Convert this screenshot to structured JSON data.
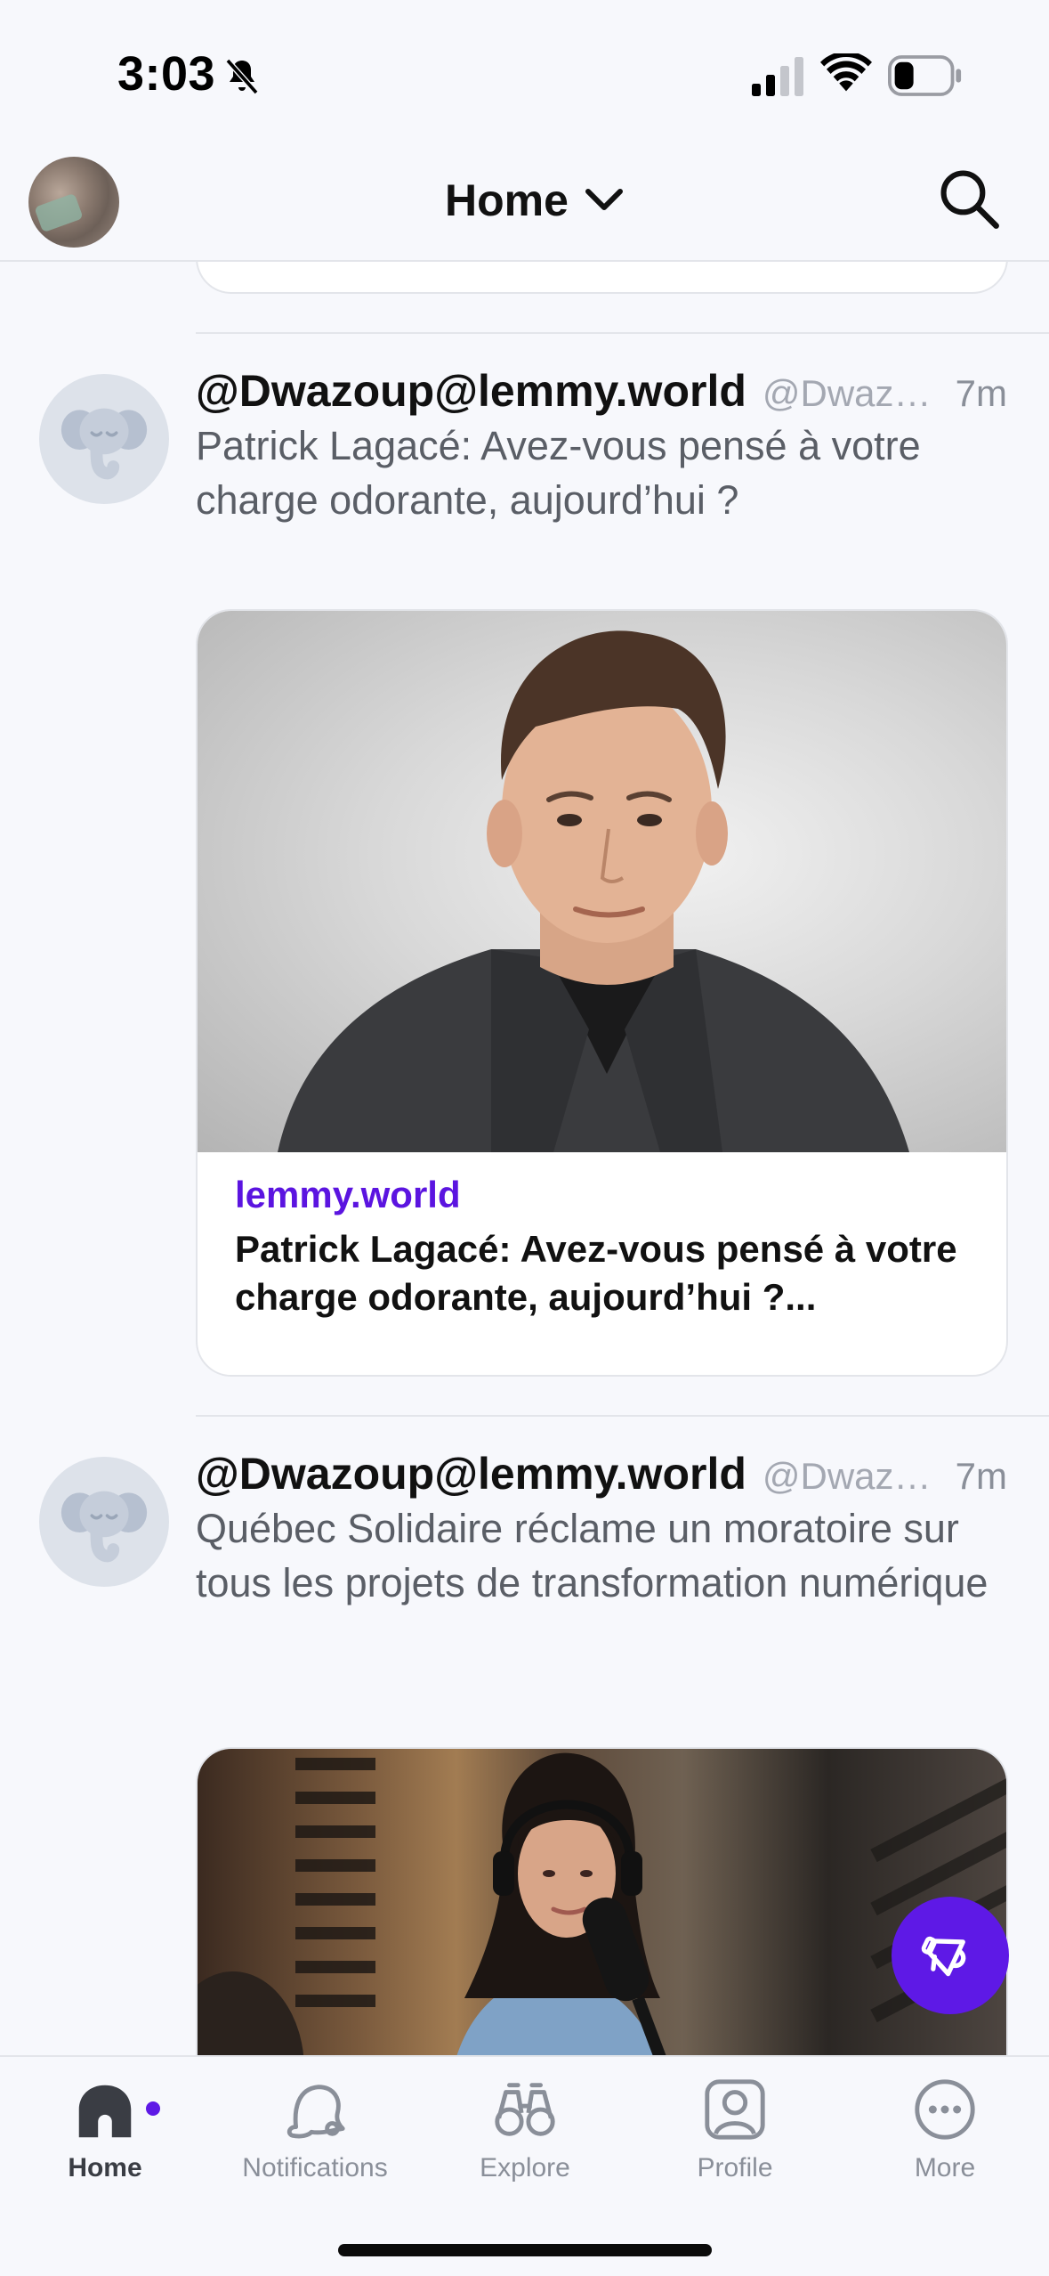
{
  "status_bar": {
    "time": "3:03"
  },
  "header": {
    "title": "Home"
  },
  "posts": [
    {
      "author": "@Dwazoup@lemmy.world",
      "handle": "@Dwaz…",
      "time": "7m",
      "text": "Patrick Lagacé: Avez-vous pensé à votre charge odorante, aujourd’hui ?",
      "card": {
        "domain": "lemmy.world",
        "title": "Patrick Lagacé: Avez-vous pensé à votre charge odorante, aujourd’hui ?..."
      }
    },
    {
      "author": "@Dwazoup@lemmy.world",
      "handle": "@Dwaz…",
      "time": "7m",
      "text": "Québec Solidaire réclame un moratoire sur tous les projets de transformation numérique"
    }
  ],
  "tabs": [
    {
      "label": "Home",
      "icon": "home-icon"
    },
    {
      "label": "Notifications",
      "icon": "bell-icon"
    },
    {
      "label": "Explore",
      "icon": "binoculars-icon"
    },
    {
      "label": "Profile",
      "icon": "person-icon"
    },
    {
      "label": "More",
      "icon": "ellipsis-icon"
    }
  ],
  "colors": {
    "accent": "#5e19e6",
    "background": "#f7f8fc"
  }
}
